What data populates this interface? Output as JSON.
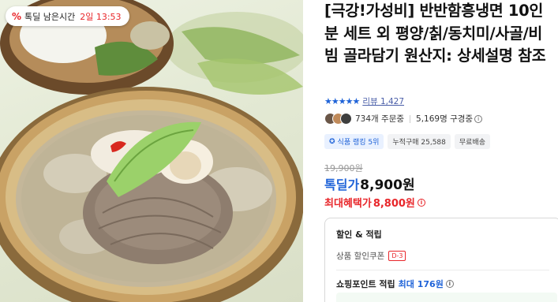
{
  "timer_badge": {
    "icon": "percent-tag-icon",
    "label": "톡딜 남은시간",
    "time": "2일 13:53"
  },
  "product": {
    "title": "[극강!가성비] 반반함흥냉면 10인분 세트 외 평양/칡/동치미/사골/비빔 골라담기 원산지: 상세설명 참조",
    "rating_stars": "★★★★★",
    "rating_value": 5,
    "review_label": "리뷰 1,427",
    "orders": "734개 주문중",
    "subscribers": "5,169명 구경중",
    "ranking_tag": "식품 랭킹 5위",
    "cumulative_tag": "누적구매 25,588",
    "shipping_tag": "무료배송",
    "original_price": "19,900원",
    "deal_label": "톡딜가",
    "deal_price": "8,900원",
    "benefit_label": "최대혜택가",
    "benefit_price": "8,800원"
  },
  "discount_box": {
    "title": "할인 & 적립",
    "coupon_label": "상품 할인쿠폰",
    "coupon_badge": "D-3",
    "points_label": "쇼핑포인트 적립",
    "points_max": "최대 176원"
  },
  "colors": {
    "accent_blue": "#1f63d8",
    "accent_red": "#e8262a"
  }
}
